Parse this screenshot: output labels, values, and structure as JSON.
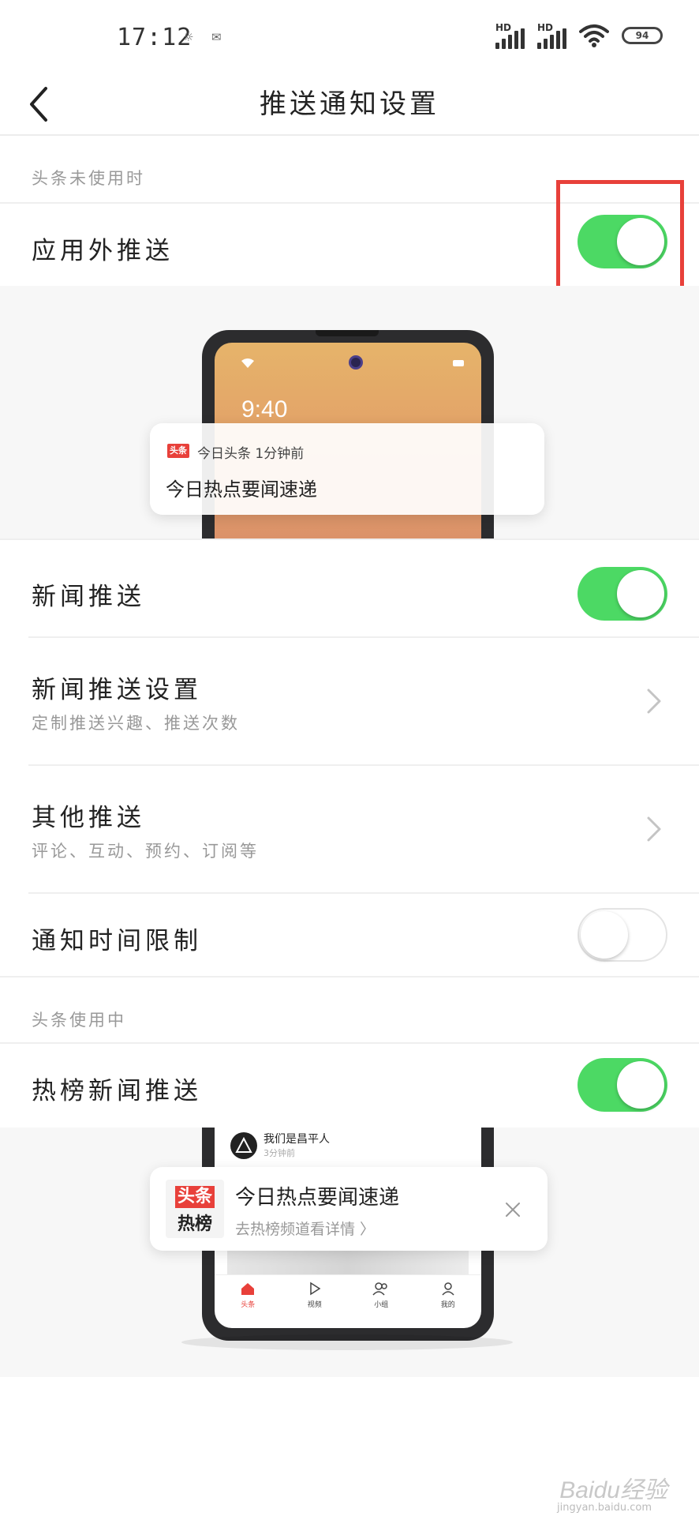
{
  "status_bar": {
    "time": "17:12",
    "mini_icons": [
      "☼",
      "✉"
    ],
    "signal1_label": "HD",
    "signal2_label": "HD",
    "battery": "94"
  },
  "nav": {
    "title": "推送通知设置"
  },
  "section_idle": {
    "label": "头条未使用时",
    "outside_push": {
      "title": "应用外推送",
      "enabled": true
    }
  },
  "preview_lock": {
    "time": "9:40",
    "badge": "头条",
    "app_line": "今日头条 1分钟前",
    "message": "今日热点要闻速递"
  },
  "settings": [
    {
      "title": "新闻推送",
      "type": "toggle",
      "enabled": true
    },
    {
      "title": "新闻推送设置",
      "subtitle": "定制推送兴趣、推送次数",
      "type": "link"
    },
    {
      "title": "其他推送",
      "subtitle": "评论、互动、预约、订阅等",
      "type": "link"
    },
    {
      "title": "通知时间限制",
      "type": "toggle",
      "enabled": false
    }
  ],
  "section_active": {
    "label": "头条使用中",
    "hot_push": {
      "title": "热榜新闻推送",
      "enabled": true
    }
  },
  "preview_app": {
    "author": "我们是昌平人",
    "author_time": "3分钟前",
    "hot_badge_top": "头条",
    "hot_badge_bottom": "热榜",
    "message": "今日热点要闻速递",
    "link": "去热榜频道看详情 〉",
    "tabs": [
      "头条",
      "视频",
      "小组",
      "我的"
    ]
  },
  "watermark": {
    "brand": "Baidu经验",
    "url": "jingyan.baidu.com"
  },
  "colors": {
    "toggle_on": "#4cd964",
    "highlight": "#e8403a",
    "brand_red": "#e8403a"
  }
}
